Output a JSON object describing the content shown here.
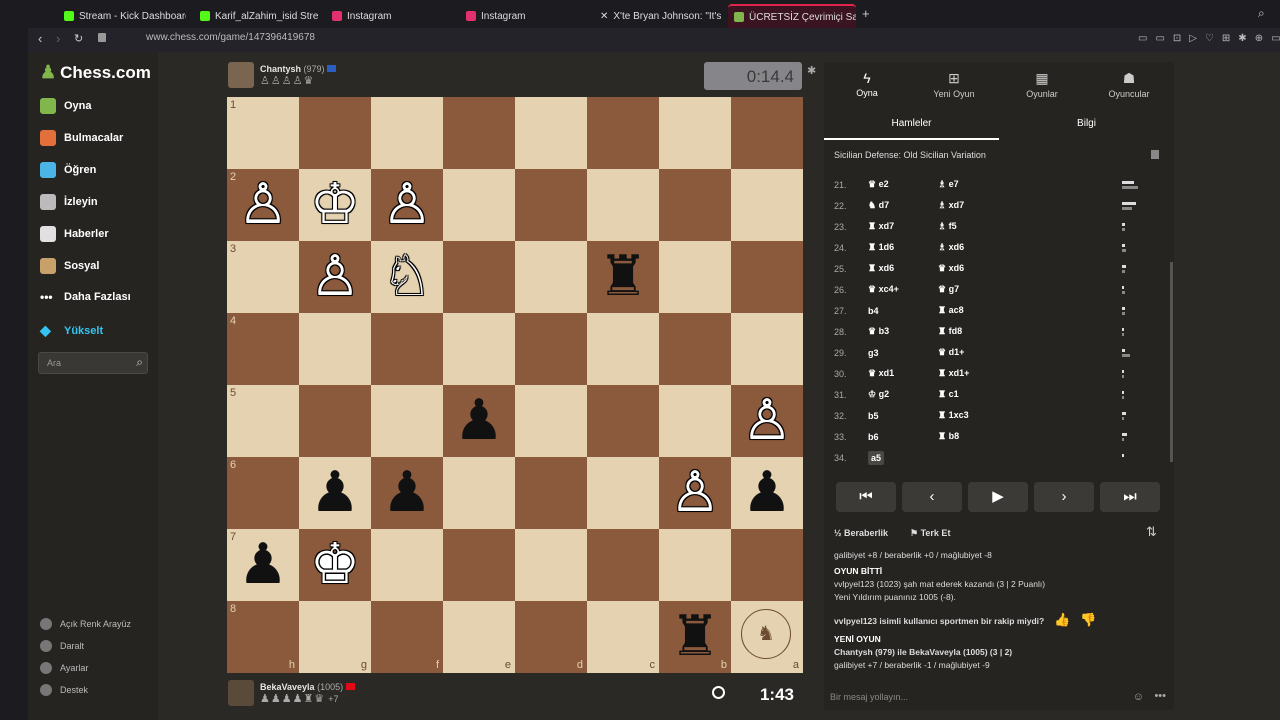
{
  "tabs": [
    {
      "label": "Stream - Kick Dashboard",
      "color": "#53fc18"
    },
    {
      "label": "Karif_alZahim_isid Stream",
      "color": "#53fc18"
    },
    {
      "label": "Instagram",
      "color": "#e1306c"
    },
    {
      "label": "Instagram",
      "color": "#e1306c"
    },
    {
      "label": "X'te Bryan Johnson: \"It's n",
      "color": "#ffffff"
    },
    {
      "label": "ÜCRETSİZ Çevrimiçi Sa",
      "color": "#81b64c"
    }
  ],
  "address": {
    "url": "www.chess.com/game/147396419678"
  },
  "sidebar": {
    "logo": "Chess.com",
    "items": [
      {
        "label": "Oyna",
        "color": "#81b64c"
      },
      {
        "label": "Bulmacalar",
        "color": "#e36f3a"
      },
      {
        "label": "Öğren",
        "color": "#4bb4e6"
      },
      {
        "label": "İzleyin",
        "color": "#bbbbbb"
      },
      {
        "label": "Haberler",
        "color": "#e0e0e0"
      },
      {
        "label": "Sosyal",
        "color": "#c8a06a"
      },
      {
        "label": "Daha Fazlası",
        "color": "#bbbbbb"
      },
      {
        "label": "Yükselt",
        "color": "#35c4f0"
      }
    ],
    "search_placeholder": "Ara",
    "bottom": [
      "Açık Renk Arayüz",
      "Daralt",
      "Ayarlar",
      "Destek"
    ]
  },
  "top_player": {
    "name": "Chantysh",
    "rating": "(979)",
    "captured": "♙♙♙♙♛"
  },
  "bottom_player": {
    "name": "BekaVaveyla",
    "rating": "(1005)",
    "captured": "♟♟♟♟♜♛",
    "extra": "+7"
  },
  "clocks": {
    "top": "0:14.4",
    "bottom": "1:43"
  },
  "board": {
    "ranks": [
      "1",
      "2",
      "3",
      "4",
      "5",
      "6",
      "7",
      "8"
    ],
    "files": [
      "h",
      "g",
      "f",
      "e",
      "d",
      "c",
      "b",
      "a"
    ],
    "pieces": [
      {
        "sq": "b2",
        "glyph": "♙",
        "color": "w"
      },
      {
        "sq": "c2",
        "glyph": "♔",
        "color": "w"
      },
      {
        "sq": "d2",
        "glyph": "♙",
        "color": "w"
      },
      {
        "sq": "c3",
        "glyph": "♙",
        "color": "w"
      },
      {
        "sq": "d3",
        "glyph": "♘",
        "color": "w"
      },
      {
        "sq": "g3",
        "glyph": "♜",
        "color": "b"
      },
      {
        "sq": "e5",
        "glyph": "♟",
        "color": "b"
      },
      {
        "sq": "i5",
        "glyph": "♙",
        "color": "w"
      },
      {
        "sq": "c6",
        "glyph": "♟",
        "color": "b"
      },
      {
        "sq": "d6",
        "glyph": "♟",
        "color": "b"
      },
      {
        "sq": "h6",
        "glyph": "♙",
        "color": "w"
      },
      {
        "sq": "i6",
        "glyph": "♟",
        "color": "b"
      },
      {
        "sq": "b7",
        "glyph": "♟",
        "color": "b"
      },
      {
        "sq": "c7",
        "glyph": "♚",
        "color": "w"
      },
      {
        "sq": "h8",
        "glyph": "♜",
        "color": "b"
      }
    ],
    "logo_text": "THE HOUSE OF STAUNTON"
  },
  "panel": {
    "tabs": [
      "Oyna",
      "Yeni Oyun",
      "Oyunlar",
      "Oyuncular"
    ],
    "subtabs": [
      "Hamleler",
      "Bilgi"
    ],
    "opening": "Sicilian Defense: Old Sicilian Variation",
    "moves": [
      {
        "n": "21.",
        "w": "♛ e2",
        "b": "♗ e7",
        "bw": [
          12,
          16
        ]
      },
      {
        "n": "22.",
        "w": "♞ d7",
        "b": "♗ xd7",
        "bw": [
          14,
          10
        ]
      },
      {
        "n": "23.",
        "w": "♜ xd7",
        "b": "♗ f5",
        "bw": [
          3,
          3
        ]
      },
      {
        "n": "24.",
        "w": "♜ 1d6",
        "b": "♗ xd6",
        "bw": [
          3,
          4
        ]
      },
      {
        "n": "25.",
        "w": "♜ xd6",
        "b": "♛ xd6",
        "bw": [
          4,
          3
        ]
      },
      {
        "n": "26.",
        "w": "♛ xc4+",
        "b": "♛ g7",
        "bw": [
          2,
          3
        ]
      },
      {
        "n": "27.",
        "w": "b4",
        "b": "♜ ac8",
        "bw": [
          3,
          3
        ]
      },
      {
        "n": "28.",
        "w": "♛ b3",
        "b": "♜ fd8",
        "bw": [
          2,
          2
        ]
      },
      {
        "n": "29.",
        "w": "g3",
        "b": "♛ d1+",
        "bw": [
          3,
          8
        ]
      },
      {
        "n": "30.",
        "w": "♛ xd1",
        "b": "♜ xd1+",
        "bw": [
          2,
          2
        ]
      },
      {
        "n": "31.",
        "w": "♔ g2",
        "b": "♜ c1",
        "bw": [
          2,
          2
        ]
      },
      {
        "n": "32.",
        "w": "b5",
        "b": "♜ 1xc3",
        "bw": [
          4,
          2
        ]
      },
      {
        "n": "33.",
        "w": "b6",
        "b": "♜ b8",
        "bw": [
          5,
          2
        ]
      },
      {
        "n": "34.",
        "w": "a5",
        "b": "",
        "bw": [
          2,
          0
        ]
      }
    ],
    "actions": {
      "draw": "Beraberlik",
      "resign": "Terk Et"
    },
    "chat": {
      "line1": "galibiyet +8 / beraberlik +0 / mağlubiyet -8",
      "over": "OYUN BİTTİ",
      "result": "vvlpyel123 (1023) şah mat ederek kazandı (3 | 2 Puanlı)",
      "newrating": "Yeni Yıldırım puanınız 1005 (-8).",
      "sport": "vvlpyel123 isimli kullanıcı sportmen bir rakip miydi?",
      "newgame": "YENİ OYUN",
      "match": "Chantysh (979) ile BekaVaveyla (1005) (3 | 2)",
      "line2": "galibiyet +7 / beraberlik -1 / mağlubiyet -9"
    },
    "message_placeholder": "Bir mesaj yollayın..."
  }
}
